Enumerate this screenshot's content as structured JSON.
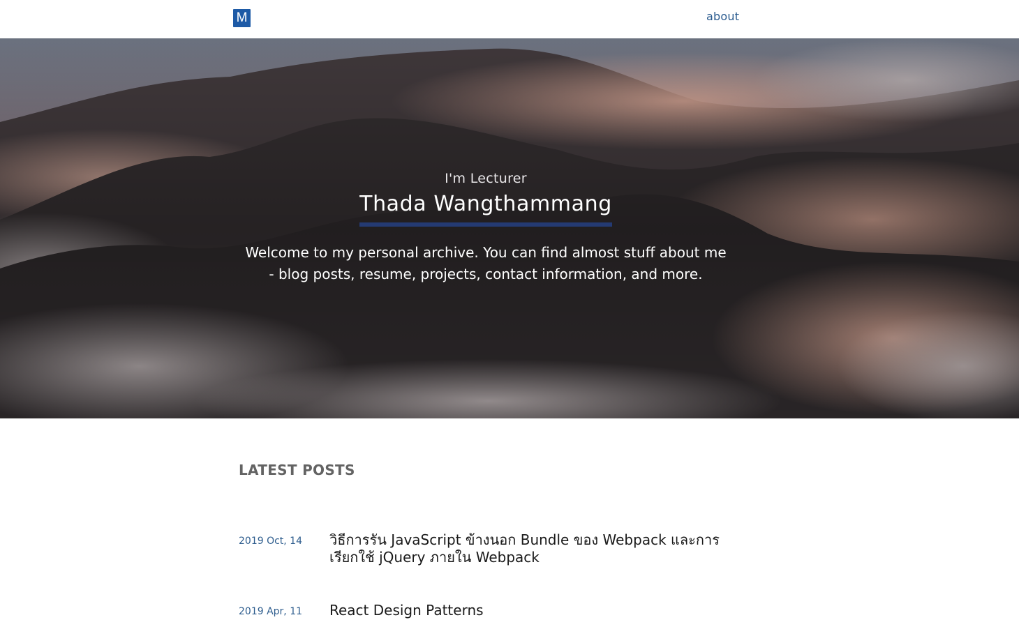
{
  "navbar": {
    "logo_text": "M",
    "about_label": "about",
    "logo_color": "#1d5aa6",
    "link_color": "#2a5b8f"
  },
  "hero": {
    "subtitle": "I'm Lecturer",
    "title": "Thada Wangthammang",
    "description": "Welcome to my personal archive. You can find almost stuff about me - blog posts, resume, projects, contact information, and more.",
    "underline_color": "#243a72"
  },
  "latest_posts": {
    "heading": "LATEST POSTS",
    "posts": [
      {
        "date": "2019 Oct, 14",
        "title": "วิธีการรัน JavaScript ข้างนอก Bundle ของ Webpack และการเรียกใช้ jQuery ภายใน Webpack"
      },
      {
        "date": "2019 Apr, 11",
        "title": "React Design Patterns"
      }
    ]
  }
}
